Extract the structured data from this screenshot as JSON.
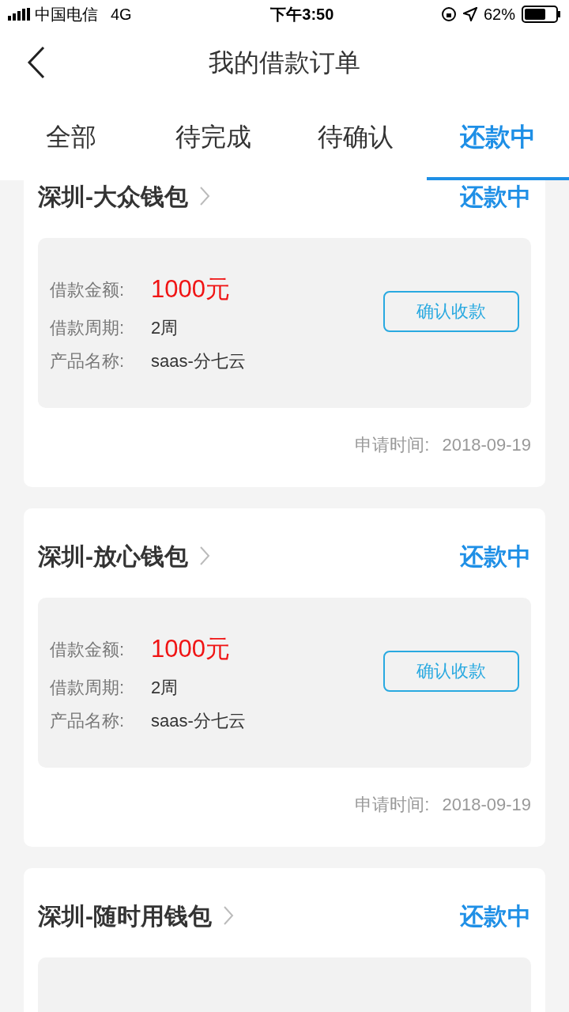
{
  "status_bar": {
    "carrier": "中国电信",
    "network": "4G",
    "time": "下午3:50",
    "battery": "62%"
  },
  "nav": {
    "title": "我的借款订单"
  },
  "tabs": [
    {
      "label": "全部",
      "selected": false
    },
    {
      "label": "待完成",
      "selected": false
    },
    {
      "label": "待确认",
      "selected": false
    },
    {
      "label": "还款中",
      "selected": true
    }
  ],
  "orders": [
    {
      "name": "深圳-大众钱包",
      "status": "还款中",
      "amount_label": "借款金额:",
      "amount": "1000元",
      "period_label": "借款周期:",
      "period": "2周",
      "product_label": "产品名称:",
      "product": "saas-分七云",
      "button": "确认收款",
      "date_label": "申请时间:",
      "date": "2018-09-19"
    },
    {
      "name": "深圳-放心钱包",
      "status": "还款中",
      "amount_label": "借款金额:",
      "amount": "1000元",
      "period_label": "借款周期:",
      "period": "2周",
      "product_label": "产品名称:",
      "product": "saas-分七云",
      "button": "确认收款",
      "date_label": "申请时间:",
      "date": "2018-09-19"
    },
    {
      "name": "深圳-随时用钱包",
      "status": "还款中"
    }
  ]
}
